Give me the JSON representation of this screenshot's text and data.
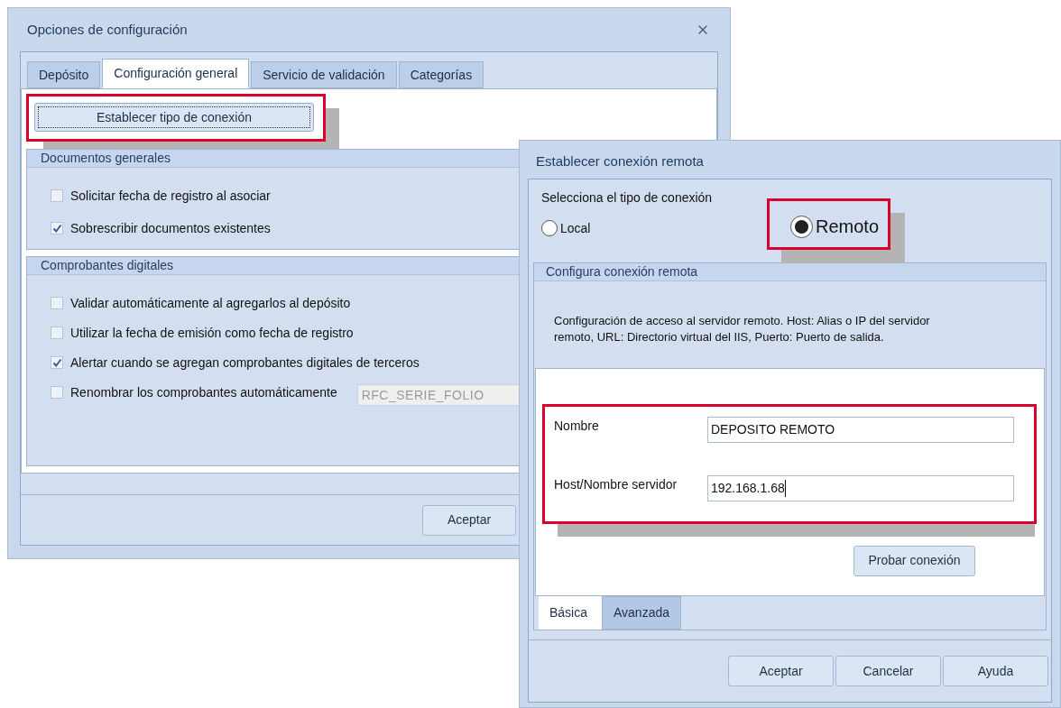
{
  "options_window": {
    "title": "Opciones de configuración",
    "tabs": [
      {
        "label": "Depósito",
        "selected": false
      },
      {
        "label": "Configuración general",
        "selected": true
      },
      {
        "label": "Servicio de validación",
        "selected": false
      },
      {
        "label": "Categorías",
        "selected": false
      }
    ],
    "connection_button": {
      "label": "Establecer tipo de conexión",
      "highlighted": true
    },
    "groups": [
      {
        "title": "Documentos generales",
        "options": [
          {
            "label": "Solicitar fecha de registro al asociar",
            "checked": false
          },
          {
            "label": "Sobrescribir documentos existentes",
            "checked": true
          }
        ]
      },
      {
        "title": "Comprobantes digitales",
        "options": [
          {
            "label": "Validar automáticamente al agregarlos al depósito",
            "checked": false
          },
          {
            "label": "Utilizar la fecha de emisión como fecha de registro",
            "checked": false
          },
          {
            "label": "Alertar cuando se agregan comprobantes digitales de terceros",
            "checked": true
          },
          {
            "label": "Renombrar los comprobantes automáticamente",
            "checked": false,
            "field": {
              "value": "RFC_SERIE_FOLIO",
              "disabled": true
            }
          }
        ]
      }
    ],
    "buttons": [
      "Aceptar"
    ]
  },
  "remote_window": {
    "title": "Establecer conexión remota",
    "connection_type": {
      "label": "Selecciona el tipo de conexión",
      "options": [
        {
          "label": "Local",
          "selected": false,
          "highlighted": false
        },
        {
          "label": "Remoto",
          "selected": true,
          "highlighted": true
        }
      ]
    },
    "group": {
      "title": "Configura conexión remota",
      "description": "Configuración de acceso al servidor remoto. Host: Alias o IP del servidor remoto, URL: Directorio virtual del IIS, Puerto: Puerto de salida.",
      "fields_highlighted": true,
      "fields": [
        {
          "label": "Nombre",
          "value": "DEPOSITO REMOTO",
          "focused": false
        },
        {
          "label": "Host/Nombre servidor",
          "value": "192.168.1.68",
          "focused": true
        }
      ],
      "test_button": "Probar conexión",
      "tabs": [
        {
          "label": "Básica",
          "selected": true
        },
        {
          "label": "Avanzada",
          "selected": false
        }
      ]
    },
    "buttons": [
      "Aceptar",
      "Cancelar",
      "Ayuda"
    ]
  }
}
